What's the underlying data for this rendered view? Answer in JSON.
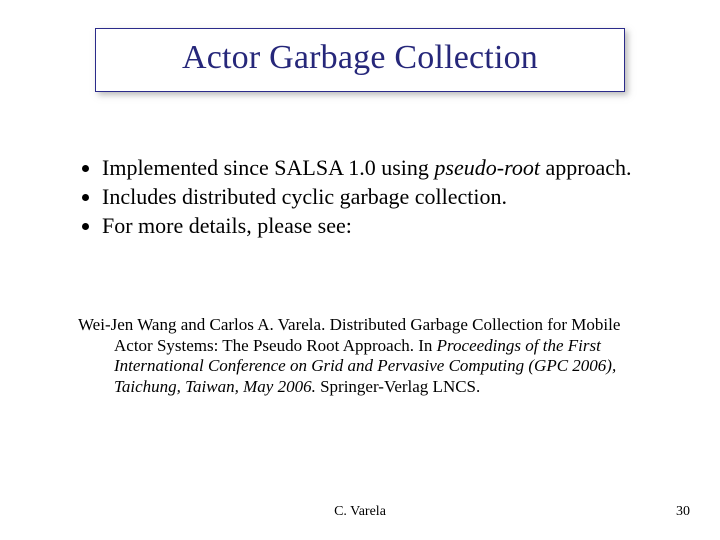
{
  "title": "Actor Garbage Collection",
  "bullets": [
    {
      "pre": "Implemented since SALSA 1.0 using ",
      "em": "pseudo-root",
      "post": " approach."
    },
    {
      "pre": "Includes distributed cyclic garbage collection.",
      "em": "",
      "post": ""
    },
    {
      "pre": "For more details, please see:",
      "em": "",
      "post": ""
    }
  ],
  "reference": {
    "authors_title_pre": "Wei-Jen Wang and Carlos A. Varela. Distributed Garbage Collection for Mobile Actor Systems: The Pseudo Root Approach. In ",
    "proceedings_em": "Proceedings of the First International Conference on Grid and Pervasive Computing (GPC 2006), Taichung, Taiwan, May 2006.",
    "tail": " Springer-Verlag LNCS."
  },
  "footer": {
    "author": "C. Varela",
    "page": "30"
  }
}
